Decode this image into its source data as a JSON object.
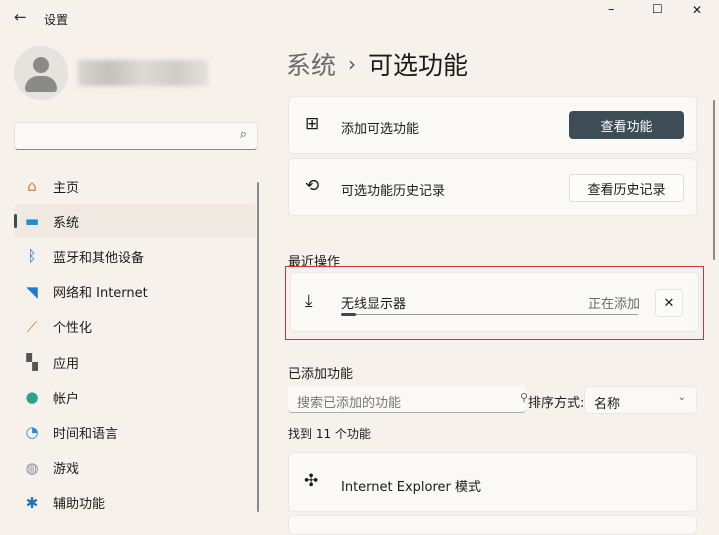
{
  "window": {
    "title": "设置",
    "back_icon": "←",
    "minimize": "–",
    "maximize": "☐",
    "close": "✕"
  },
  "sidebar": {
    "search_icon": "⌕",
    "items": [
      {
        "label": "主页",
        "icon": "home-icon"
      },
      {
        "label": "系统",
        "icon": "system-icon"
      },
      {
        "label": "蓝牙和其他设备",
        "icon": "bluetooth-icon"
      },
      {
        "label": "网络和 Internet",
        "icon": "wifi-icon"
      },
      {
        "label": "个性化",
        "icon": "brush-icon"
      },
      {
        "label": "应用",
        "icon": "apps-icon"
      },
      {
        "label": "帐户",
        "icon": "account-icon"
      },
      {
        "label": "时间和语言",
        "icon": "clock-globe-icon"
      },
      {
        "label": "游戏",
        "icon": "gamepad-icon"
      },
      {
        "label": "辅助功能",
        "icon": "accessibility-icon"
      }
    ]
  },
  "header": {
    "parent": "系统",
    "sep": "›",
    "title": "可选功能"
  },
  "add": {
    "label": "添加可选功能",
    "button": "查看功能"
  },
  "history": {
    "label": "可选功能历史记录",
    "button": "查看历史记录"
  },
  "recent": {
    "heading": "最近操作",
    "item": "无线显示器",
    "status": "正在添加",
    "progress": 0.05,
    "accent": "#3a4a55",
    "highlight": "#c8373d"
  },
  "installed": {
    "heading": "已添加功能",
    "search_placeholder": "搜索已添加的功能",
    "sort_label": "排序方式:",
    "sort_value": "名称",
    "count": "找到 11 个功能",
    "items": [
      "Internet Explorer 模式"
    ]
  }
}
